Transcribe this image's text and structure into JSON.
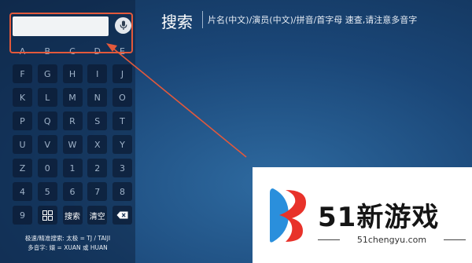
{
  "search": {
    "value": "",
    "placeholder": ""
  },
  "header": {
    "title": "搜索",
    "hint": "片名(中文)/演员(中文)/拼音/首字母 速查,请注意多音字"
  },
  "keyboard": {
    "rows": [
      [
        "A",
        "B",
        "C",
        "D",
        "E"
      ],
      [
        "F",
        "G",
        "H",
        "I",
        "J"
      ],
      [
        "K",
        "L",
        "M",
        "N",
        "O"
      ],
      [
        "P",
        "Q",
        "R",
        "S",
        "T"
      ],
      [
        "U",
        "V",
        "W",
        "X",
        "Y"
      ],
      [
        "Z",
        "0",
        "1",
        "2",
        "3"
      ],
      [
        "4",
        "5",
        "6",
        "7",
        "8"
      ]
    ],
    "digit": "9",
    "search_key": "搜索",
    "clear_key": "清空"
  },
  "help": {
    "line1": "极速/精准搜索: 太极 = TJ / TAIJI",
    "line2": "多音字: 嬛 = XUAN 或 HUAN"
  },
  "watermark": {
    "brand": "51新游戏",
    "url": "51chengyu.com"
  },
  "colors": {
    "highlight": "#e3593b",
    "logo_red": "#e8322a",
    "logo_blue": "#2a8fdc"
  }
}
